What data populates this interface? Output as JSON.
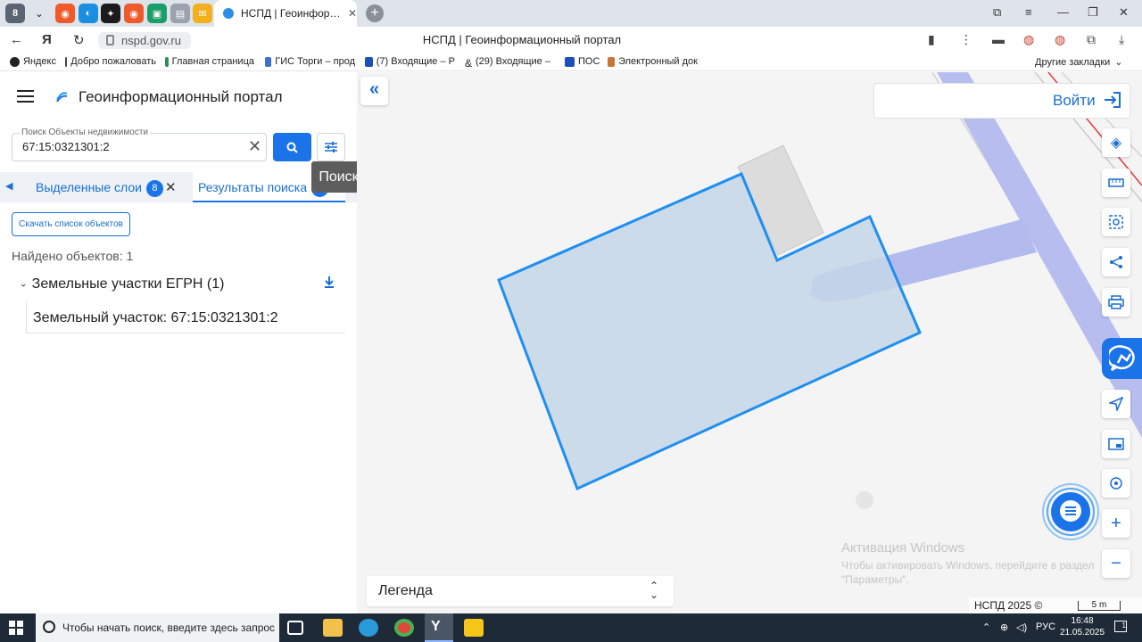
{
  "browser": {
    "tab_count_badge": "8",
    "active_tab_title": "НСПД | Геоинформац",
    "url": "nspd.gov.ru",
    "page_title": "НСПД | Геоинформационный портал",
    "bookmarks": [
      "Яндекс",
      "Добро пожаловать",
      "Главная страница",
      "ГИС Торги – прод",
      "(7) Входящие – Р",
      "(29) Входящие –",
      "ПОС",
      "Электронный док"
    ],
    "other_bookmarks": "Другие закладки"
  },
  "panel": {
    "portal_title": "Геоинформационный портал",
    "search": {
      "label": "Поиск Объекты недвижимости",
      "value": "67:15:0321301:2"
    },
    "search_tooltip": "Поиск",
    "tabs": [
      {
        "label": "Выделенные слои",
        "badge": "8"
      },
      {
        "label": "Результаты поиска",
        "badge": "1"
      }
    ],
    "download_list_label": "Скачать список объектов",
    "found_text": "Найдено объектов: 1",
    "group_label": "Земельные участки ЕГРН (1)",
    "result_item": "Земельный участок: 67:15:0321301:2"
  },
  "map": {
    "login_label": "Войти",
    "legend_label": "Легенда",
    "copyright": "НСПД 2025 ©",
    "scale_label": "5 m",
    "watermark_title": "Активация Windows",
    "watermark_text": "Чтобы активировать Windows, перейдите в раздел \"Параметры\".",
    "colors": {
      "parcel_fill": "#c4d6e8",
      "parcel_stroke": "#1e8ff0",
      "road": "#b0b8ec",
      "accent": "#1a73e8"
    },
    "tools": [
      "layers-icon",
      "ruler-icon",
      "select-area-icon",
      "share-icon",
      "print-icon",
      "chat-map-icon",
      "locate-icon",
      "minimap-icon",
      "geolocation-icon",
      "zoom-in-icon",
      "zoom-out-icon"
    ]
  },
  "taskbar": {
    "search_placeholder": "Чтобы начать поиск, введите здесь запрос",
    "language": "РУС",
    "time": "16:48",
    "date": "21.05.2025"
  }
}
